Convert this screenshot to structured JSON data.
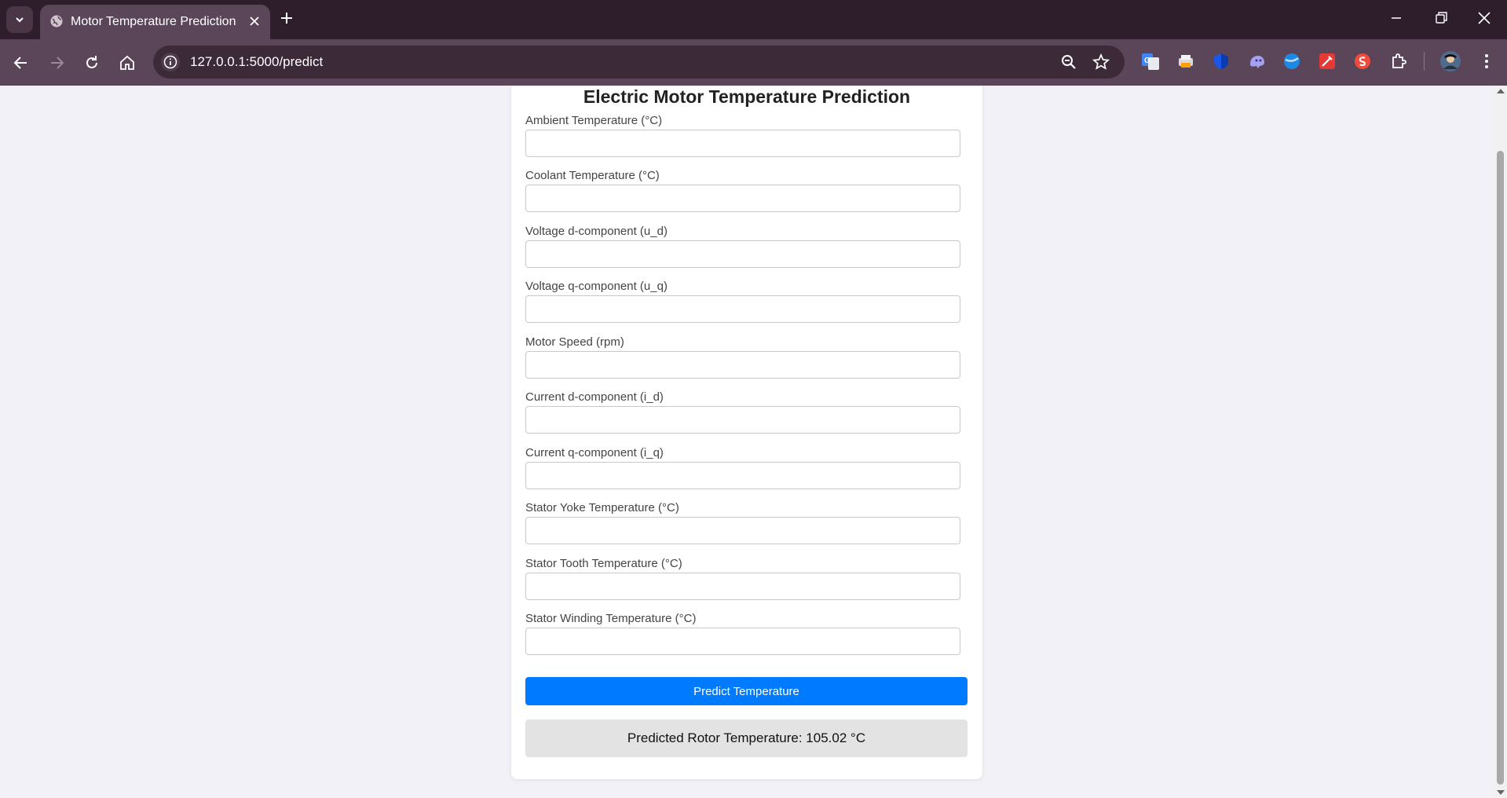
{
  "browser": {
    "tab_title": "Motor Temperature Prediction",
    "url": "127.0.0.1:5000/predict"
  },
  "page": {
    "heading": "Electric Motor Temperature Prediction",
    "fields": [
      {
        "label": "Ambient Temperature (°C)",
        "value": ""
      },
      {
        "label": "Coolant Temperature (°C)",
        "value": ""
      },
      {
        "label": "Voltage d-component (u_d)",
        "value": ""
      },
      {
        "label": "Voltage q-component (u_q)",
        "value": ""
      },
      {
        "label": "Motor Speed (rpm)",
        "value": ""
      },
      {
        "label": "Current d-component (i_d)",
        "value": ""
      },
      {
        "label": "Current q-component (i_q)",
        "value": ""
      },
      {
        "label": "Stator Yoke Temperature (°C)",
        "value": ""
      },
      {
        "label": "Stator Tooth Temperature (°C)",
        "value": ""
      },
      {
        "label": "Stator Winding Temperature (°C)",
        "value": ""
      }
    ],
    "predict_button": "Predict Temperature",
    "result": "Predicted Rotor Temperature: 105.02 °C"
  },
  "colors": {
    "accent": "#007bff",
    "chrome_frame": "#2e1e2c",
    "chrome_toolbar": "#5b4659"
  },
  "icons": [
    "tab-search-icon",
    "globe-icon",
    "close-icon",
    "plus-icon",
    "minimize-icon",
    "restore-icon",
    "back-icon",
    "forward-icon",
    "reload-icon",
    "home-icon",
    "info-icon",
    "zoom-icon",
    "star-icon",
    "google-translate-icon",
    "extension-icon",
    "profile-avatar",
    "menu-icon"
  ]
}
